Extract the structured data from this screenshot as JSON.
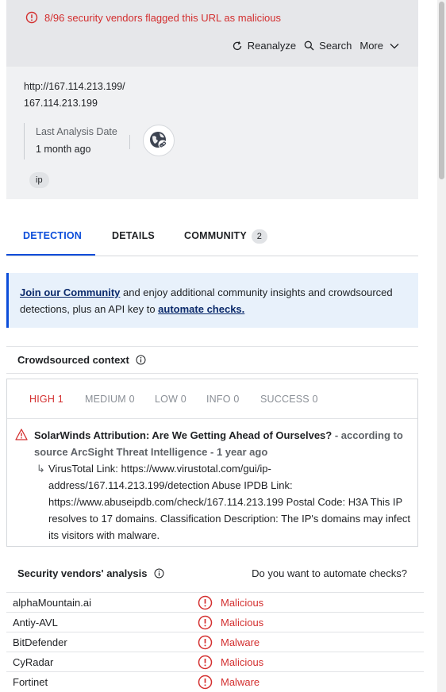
{
  "header": {
    "alert_text": "8/96 security vendors flagged this URL as malicious",
    "actions": {
      "reanalyze": "Reanalyze",
      "search": "Search",
      "more": "More"
    },
    "url": "http://167.114.213.199/",
    "host": "167.114.213.199",
    "last_analysis_label": "Last Analysis Date",
    "last_analysis_value": "1 month ago",
    "tag": "ip"
  },
  "tabs": [
    {
      "label": "DETECTION",
      "active": true
    },
    {
      "label": "DETAILS",
      "active": false
    },
    {
      "label": "COMMUNITY",
      "active": false,
      "count": "2"
    }
  ],
  "community_banner": {
    "link1": "Join our Community",
    "text1": " and enjoy additional community insights and crowdsourced detections, plus an API key to ",
    "link2": "automate checks."
  },
  "crowdsourced": {
    "title": "Crowdsourced context",
    "severities": [
      {
        "label": "HIGH 1"
      },
      {
        "label": "MEDIUM 0"
      },
      {
        "label": "LOW 0"
      },
      {
        "label": "INFO 0"
      },
      {
        "label": "SUCCESS 0"
      }
    ],
    "entry": {
      "title": "SolarWinds Attribution: Are We Getting Ahead of Ourselves?",
      "source": " - according to source ArcSight Threat Intelligence - 1 year ago",
      "body": "VirusTotal Link: https://www.virustotal.com/gui/ip-address/167.114.213.199/detection Abuse IPDB Link: https://www.abuseipdb.com/check/167.114.213.199 Postal Code: H3A This IP resolves to 17 domains. Classification Description: The IP's domains may infect its visitors with malware."
    }
  },
  "vendors": {
    "title": "Security vendors' analysis",
    "automate_question": "Do you want to automate checks?",
    "rows": [
      {
        "name": "alphaMountain.ai",
        "verdict": "Malicious"
      },
      {
        "name": "Antiy-AVL",
        "verdict": "Malicious"
      },
      {
        "name": "BitDefender",
        "verdict": "Malware"
      },
      {
        "name": "CyRadar",
        "verdict": "Malicious"
      },
      {
        "name": "Fortinet",
        "verdict": "Malware"
      }
    ]
  },
  "colors": {
    "malicious": "#d32f2f",
    "accent": "#0b4dda",
    "banner_bg": "#e8f1fb"
  }
}
